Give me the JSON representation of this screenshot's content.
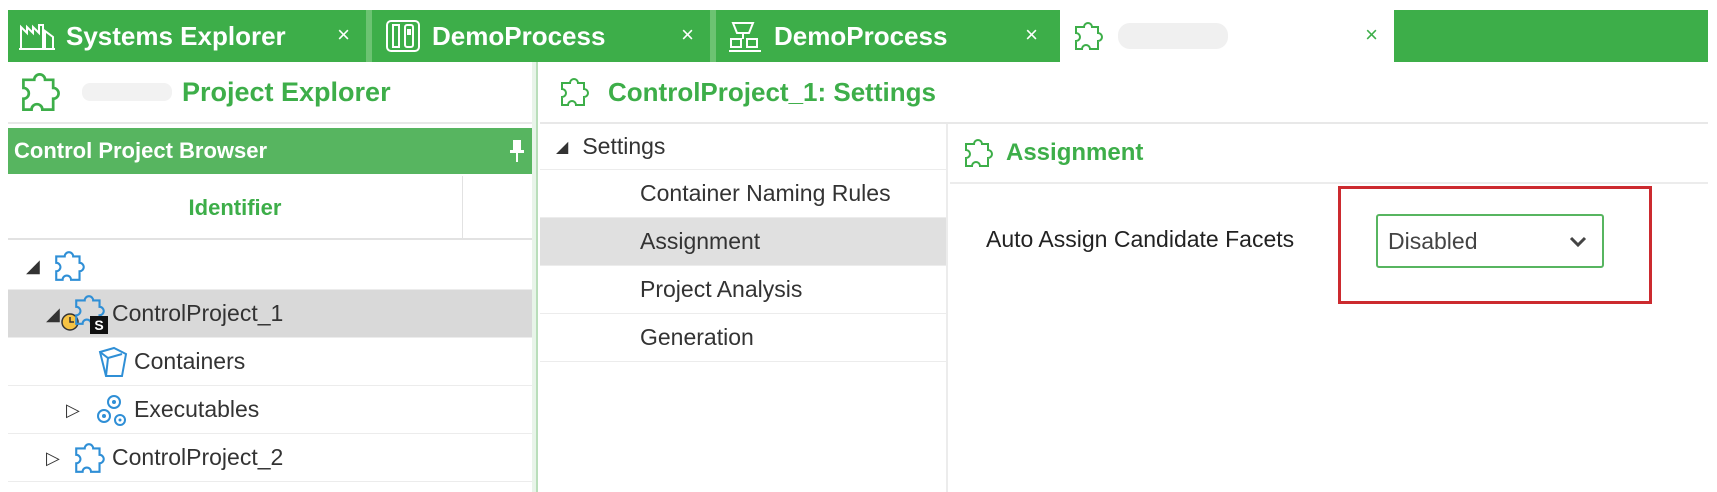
{
  "tabs": [
    {
      "label": "Systems Explorer",
      "icon": "factory-icon",
      "close": "×"
    },
    {
      "label": "DemoProcess",
      "icon": "controller-icon",
      "close": "×"
    },
    {
      "label": "DemoProcess",
      "icon": "process-icon",
      "close": "×"
    },
    {
      "label": "",
      "icon": "puzzle-icon",
      "close": "×"
    }
  ],
  "left_panel": {
    "title": "Project Explorer",
    "browser_title": "Control Project Browser",
    "column_header": "Identifier",
    "tree": [
      {
        "label": "",
        "toggle": "◢",
        "icon": "puzzle-icon"
      },
      {
        "label": "ControlProject_1",
        "toggle": "◢",
        "icon": "puzzle-icon",
        "badge": "S"
      },
      {
        "label": "Containers",
        "toggle": "",
        "icon": "container-icon"
      },
      {
        "label": "Executables",
        "toggle": "▷",
        "icon": "gear-group-icon"
      },
      {
        "label": "ControlProject_2",
        "toggle": "▷",
        "icon": "puzzle-icon"
      }
    ]
  },
  "right_panel": {
    "title": "ControlProject_1: Settings",
    "nav_root": "Settings",
    "nav_items": [
      "Container Naming Rules",
      "Assignment",
      "Project Analysis",
      "Generation"
    ],
    "section_title": "Assignment",
    "field_label": "Auto Assign Candidate Facets",
    "field_value": "Disabled"
  },
  "colors": {
    "brand_green": "#3dae49",
    "highlight_red": "#cc2a2f"
  }
}
